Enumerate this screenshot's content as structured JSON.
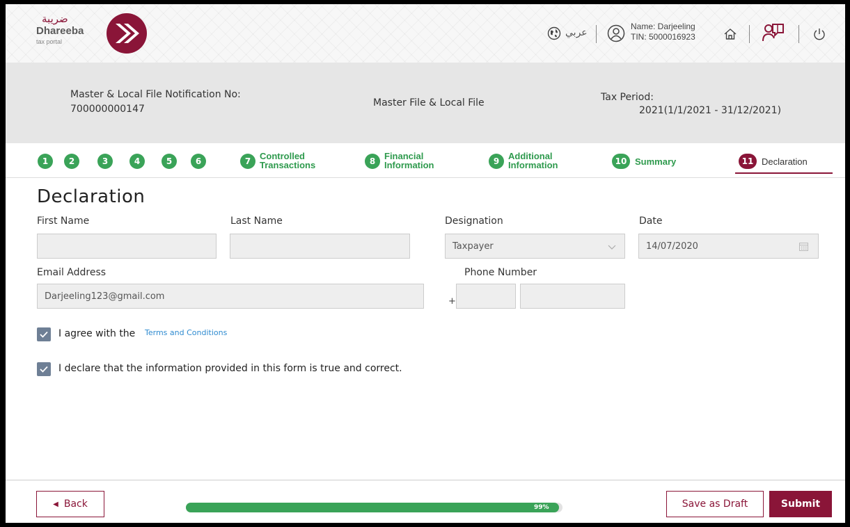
{
  "header": {
    "logo_arabic": "ضريبة",
    "logo_name": "Dhareeba",
    "logo_sub": "tax portal",
    "language_link": "عربي",
    "user_name": "Name: Darjeeling",
    "user_tin": "TIN: 5000016923",
    "icons": [
      "globe-icon",
      "user-icon",
      "home-icon",
      "support-icon",
      "power-icon"
    ]
  },
  "info": {
    "notification_label": "Master & Local File Notification No:",
    "notification_value": "700000000147",
    "file_type": "Master File & Local File",
    "period_label": "Tax Period:",
    "period_value": "2021(1/1/2021 - 31/12/2021)"
  },
  "steps": [
    {
      "num": "1",
      "line1": "",
      "line2": ""
    },
    {
      "num": "2",
      "line1": "",
      "line2": ""
    },
    {
      "num": "3",
      "line1": "",
      "line2": ""
    },
    {
      "num": "4",
      "line1": "",
      "line2": ""
    },
    {
      "num": "5",
      "line1": "",
      "line2": ""
    },
    {
      "num": "6",
      "line1": "",
      "line2": ""
    },
    {
      "num": "7",
      "line1": "Controlled",
      "line2": "Transactions"
    },
    {
      "num": "8",
      "line1": "Financial",
      "line2": "Information"
    },
    {
      "num": "9",
      "line1": "Additional",
      "line2": "Information"
    },
    {
      "num": "10",
      "line1": "Summary",
      "line2": ""
    },
    {
      "num": "11",
      "line1": "Declaration",
      "line2": "",
      "active": true
    }
  ],
  "form": {
    "title": "Declaration",
    "first_name_label": "First Name",
    "first_name_value": "",
    "last_name_label": "Last Name",
    "last_name_value": "",
    "designation_label": "Designation",
    "designation_value": "Taxpayer",
    "date_label": "Date",
    "date_value": "14/07/2020",
    "email_label": "Email Address",
    "email_value": "Darjeeling123@gmail.com",
    "phone_label": "Phone Number",
    "phone_plus": "+",
    "phone_code": "",
    "phone_number": "",
    "agree_text": "I agree with the",
    "terms_link": "Terms and Conditions",
    "agree_checked": true,
    "declare_text": "I declare that the information provided in this form is true and correct.",
    "declare_checked": true
  },
  "footer": {
    "back_label": "Back",
    "progress_value": 0.99,
    "progress_text": "99%",
    "draft_label": "Save as Draft",
    "submit_label": "Submit"
  },
  "colors": {
    "brand": "#8a1538",
    "step_green": "#3aa358",
    "link_blue": "#2f8bd0",
    "checkbox": "#6e7f95"
  }
}
